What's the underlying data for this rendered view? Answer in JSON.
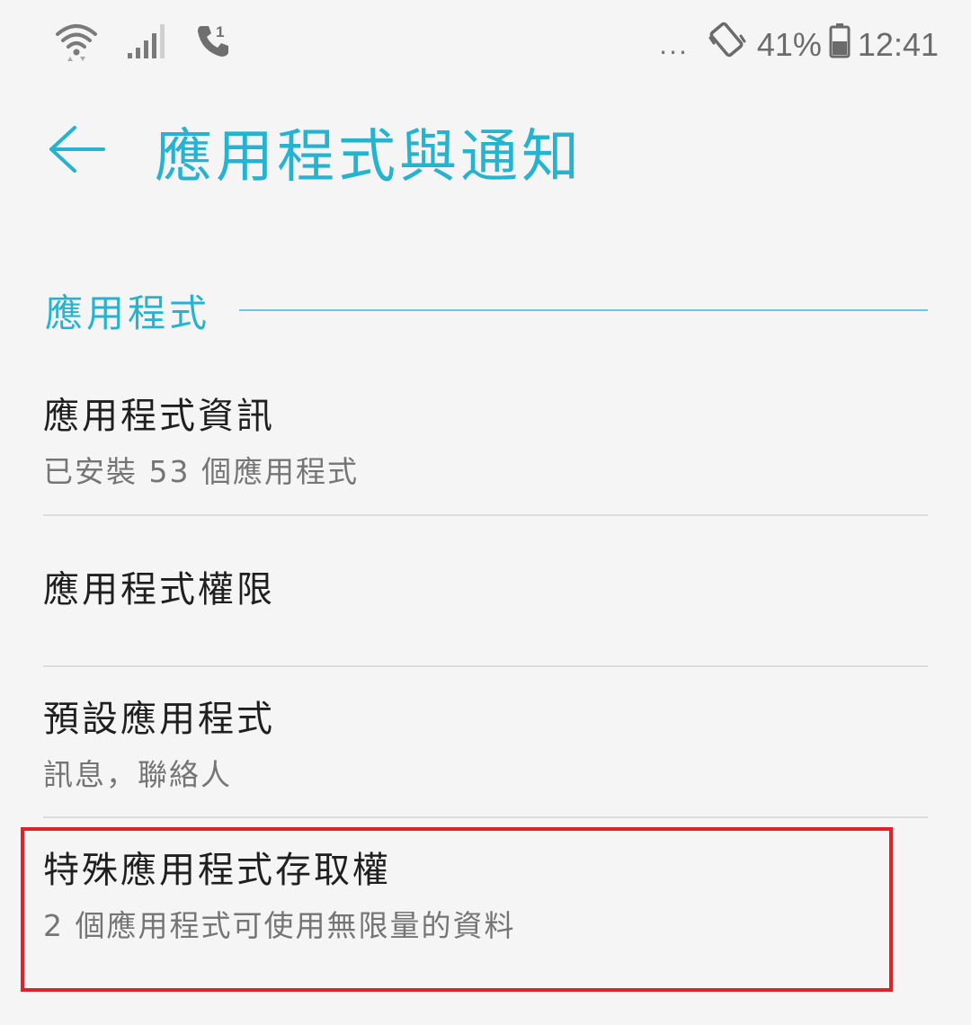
{
  "status_bar": {
    "dots": "...",
    "battery_percent": "41%",
    "time": "12:41",
    "icons": [
      "wifi-icon",
      "signal-icon",
      "call-icon",
      "vibrate-icon",
      "battery-icon"
    ]
  },
  "header": {
    "back_icon": "back-arrow-icon",
    "title": "應用程式與通知"
  },
  "section": {
    "title": "應用程式"
  },
  "items": [
    {
      "title": "應用程式資訊",
      "subtitle": "已安裝 53 個應用程式"
    },
    {
      "title": "應用程式權限",
      "subtitle": ""
    },
    {
      "title": "預設應用程式",
      "subtitle": "訊息，聯絡人"
    },
    {
      "title": "特殊應用程式存取權",
      "subtitle": "2 個應用程式可使用無限量的資料"
    }
  ],
  "colors": {
    "accent": "#25b3d0",
    "highlight": "#e0202a"
  }
}
